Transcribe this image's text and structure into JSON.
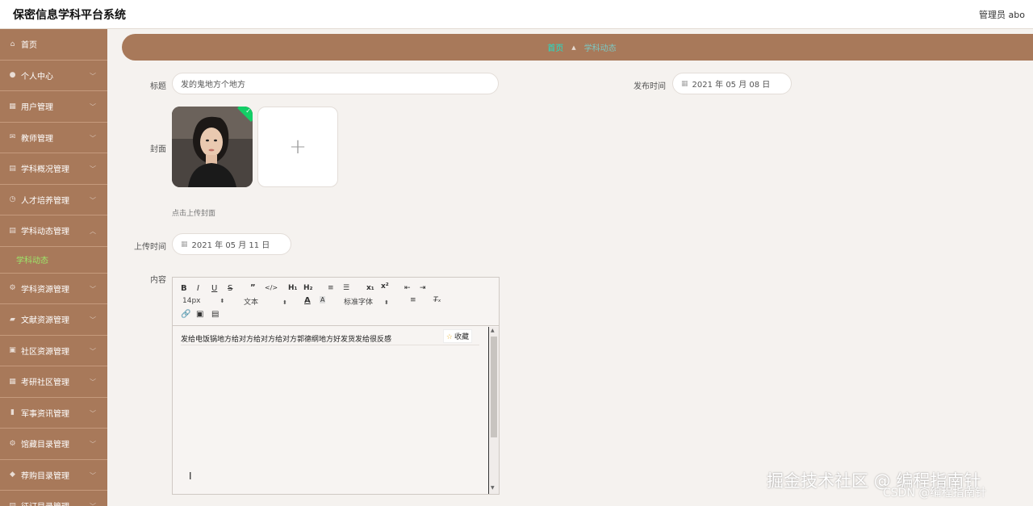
{
  "app": {
    "title": "保密信息学科平台系统",
    "user": "管理员 abo"
  },
  "sidebar": {
    "items": [
      {
        "label": "首页",
        "icon": "home-icon",
        "glyph": "⌂",
        "chevron": false
      },
      {
        "label": "个人中心",
        "icon": "user-icon",
        "glyph": "●",
        "chevron": true
      },
      {
        "label": "用户管理",
        "icon": "table-icon",
        "glyph": "▦",
        "chevron": true
      },
      {
        "label": "教师管理",
        "icon": "mail-icon",
        "glyph": "✉",
        "chevron": true
      },
      {
        "label": "学科概况管理",
        "icon": "grid-icon",
        "glyph": "▤",
        "chevron": true
      },
      {
        "label": "人才培养管理",
        "icon": "clock-icon",
        "glyph": "◷",
        "chevron": true
      },
      {
        "label": "学科动态管理",
        "icon": "list-icon",
        "glyph": "▤",
        "chevron": true,
        "expanded": true
      },
      {
        "label": "学科资源管理",
        "icon": "settings-icon",
        "glyph": "⚙",
        "chevron": true
      },
      {
        "label": "文献资源管理",
        "icon": "book-icon",
        "glyph": "▰",
        "chevron": true
      },
      {
        "label": "社区资源管理",
        "icon": "cart-icon",
        "glyph": "▣",
        "chevron": true
      },
      {
        "label": "考研社区管理",
        "icon": "apps-icon",
        "glyph": "▦",
        "chevron": true
      },
      {
        "label": "军事资讯管理",
        "icon": "chart-icon",
        "glyph": "▮",
        "chevron": true
      },
      {
        "label": "馆藏目录管理",
        "icon": "settings-icon",
        "glyph": "⚙",
        "chevron": true
      },
      {
        "label": "荐购目录管理",
        "icon": "shield-icon",
        "glyph": "◆",
        "chevron": true
      },
      {
        "label": "征订目录管理",
        "icon": "list-icon",
        "glyph": "▤",
        "chevron": true
      }
    ],
    "submenu": {
      "label": "学科动态"
    }
  },
  "breadcrumb": {
    "home": "首页",
    "current": "学科动态"
  },
  "form": {
    "title_label": "标题",
    "title_value": "发的鬼地方个地方",
    "publish_label": "发布时间",
    "publish_value": "2021 年 05 月 08 日",
    "cover_label": "封面",
    "cover_hint": "点击上传封面",
    "upload_time_label": "上传时间",
    "upload_time_value": "2021 年 05 月 11 日",
    "content_label": "内容"
  },
  "editor": {
    "font_size": "14px",
    "header_select": "文本",
    "font_select": "标准字体",
    "content": "发给电饭锅地方给对方给对方给对方郭德纲地方好发货发给很反感",
    "favorite_label": "收藏"
  },
  "watermark": {
    "line1": "掘金技术社区 @ 编程指南针",
    "line2": "CSDN @编程指南针"
  }
}
